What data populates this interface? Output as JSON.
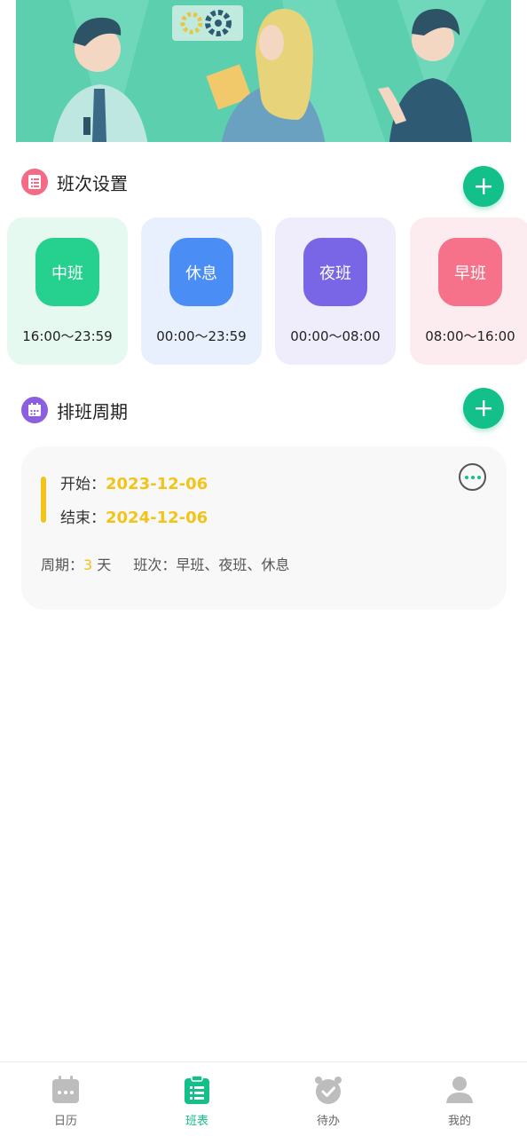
{
  "sections": {
    "shift_settings": {
      "title": "班次设置",
      "icon": "list-icon",
      "color": "#f46b86"
    },
    "schedule_cycle": {
      "title": "排班周期",
      "icon": "calendar-icon",
      "color": "#8b5fe0"
    }
  },
  "shifts": [
    {
      "name": "中班",
      "time": "16:00～23:59",
      "color": "#26d08f",
      "bg": "#e6f9f1"
    },
    {
      "name": "休息",
      "time": "00:00～23:59",
      "color": "#4a8ef5",
      "bg": "#e8f0fd"
    },
    {
      "name": "夜班",
      "time": "00:00～08:00",
      "color": "#7966e6",
      "bg": "#efedfc"
    },
    {
      "name": "早班",
      "time": "08:00～16:00",
      "color": "#f5728a",
      "bg": "#fdecef"
    }
  ],
  "cycle": {
    "start_label": "开始：",
    "start_date": "2023-12-06",
    "end_label": "结束：",
    "end_date": "2024-12-06",
    "period_label": "周期：",
    "period_days": "3",
    "days_unit": "天",
    "shifts_label": "班次：",
    "shifts_value": "早班、夜班、休息"
  },
  "tabs": [
    {
      "label": "日历",
      "icon": "calendar-icon"
    },
    {
      "label": "班表",
      "icon": "clipboard-icon"
    },
    {
      "label": "待办",
      "icon": "alarm-clock-icon"
    },
    {
      "label": "我的",
      "icon": "user-icon"
    }
  ],
  "active_tab": "班表",
  "colors": {
    "accent": "#14c08a",
    "highlight": "#f2c419"
  }
}
